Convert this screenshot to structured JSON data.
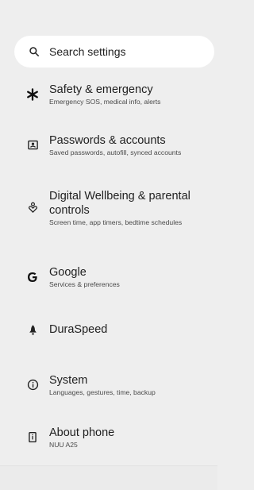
{
  "search": {
    "placeholder": "Search settings",
    "icon": "search-icon"
  },
  "items": [
    {
      "icon": "asterisk-icon",
      "title": "Safety & emergency",
      "subtitle": "Emergency SOS, medical info, alerts"
    },
    {
      "icon": "password-icon",
      "title": "Passwords & accounts",
      "subtitle": "Saved passwords, autofill, synced accounts"
    },
    {
      "icon": "wellbeing-icon",
      "title": "Digital Wellbeing & parental controls",
      "subtitle": "Screen time, app timers, bedtime schedules"
    },
    {
      "icon": "google-icon",
      "title": "Google",
      "subtitle": "Services & preferences"
    },
    {
      "icon": "rocket-icon",
      "title": "DuraSpeed",
      "subtitle": ""
    },
    {
      "icon": "info-icon",
      "title": "System",
      "subtitle": "Languages, gestures, time, backup"
    },
    {
      "icon": "phone-info-icon",
      "title": "About phone",
      "subtitle": "NUU A25"
    }
  ]
}
